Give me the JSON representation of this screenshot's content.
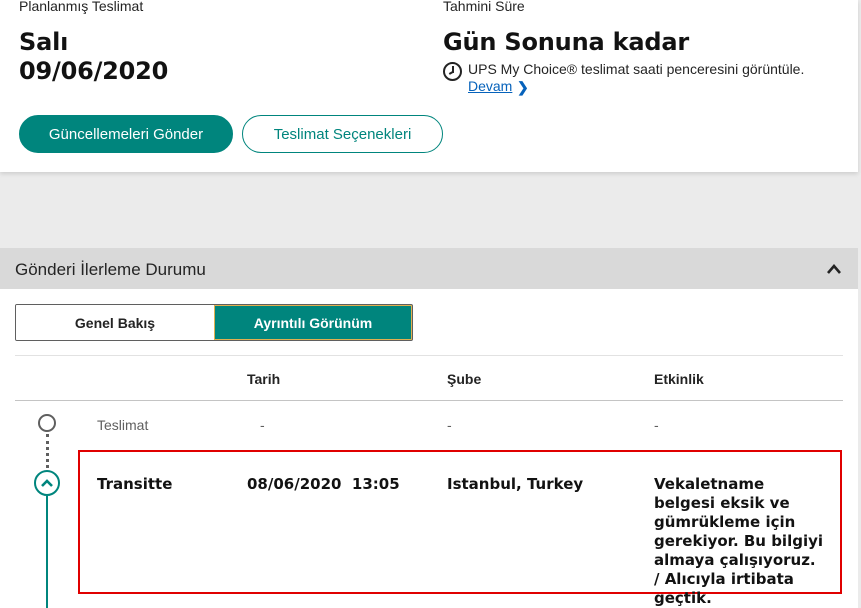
{
  "delivery": {
    "planned_label": "Planlanmış Teslimat",
    "planned_day": "Salı",
    "planned_date": "09/06/2020",
    "estimated_label": "Tahmini Süre",
    "estimated_value": "Gün Sonuna kadar",
    "choice_text": "UPS My Choice® teslimat saati penceresini görüntüle.",
    "devam_label": "Devam",
    "send_updates_label": "Güncellemeleri Gönder",
    "delivery_options_label": "Teslimat Seçenekleri"
  },
  "progress": {
    "title": "Gönderi İlerleme Durumu",
    "tabs": [
      "Genel Bakış",
      "Ayrıntılı Görünüm"
    ],
    "active_tab": "Ayrıntılı Görünüm",
    "columns": {
      "date": "Tarih",
      "branch": "Şube",
      "activity": "Etkinlik"
    },
    "rows": [
      {
        "status": "Teslimat",
        "date": "-",
        "branch": "-",
        "activity": "-"
      },
      {
        "status": "Transitte",
        "date": "08/06/2020  13:05",
        "branch": "Istanbul, Turkey",
        "activity": "Vekaletname belgesi eksik ve gümrükleme için gerekiyor. Bu bilgiyi almaya çalışıyoruz. / Alıcıyla irtibata geçtik."
      }
    ]
  },
  "colors": {
    "accent": "#00857d",
    "link": "#0662bb",
    "highlight": "#e00000"
  },
  "icons": [
    "clock-icon",
    "chevron-right-icon",
    "chevron-up-icon"
  ]
}
